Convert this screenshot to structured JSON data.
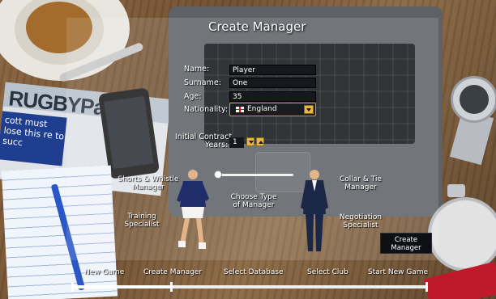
{
  "screen": {
    "title": "Create Manager"
  },
  "background": {
    "newspaper_masthead": "RUGBYPa",
    "newspaper_snippet": "cott must lose this re to succ"
  },
  "form": {
    "name": {
      "label": "Name:",
      "value": "Player"
    },
    "surname": {
      "label": "Surname:",
      "value": "One"
    },
    "age": {
      "label": "Age:",
      "value": "35"
    },
    "nationality": {
      "label": "Nationality:",
      "value": "England"
    },
    "contract": {
      "label_line1": "Initial Contract",
      "label_line2": "Years:",
      "value": "1"
    }
  },
  "manager_type": {
    "left_top": {
      "line1": "Shorts & Whistle",
      "line2": "Manager"
    },
    "left_bottom": {
      "line1": "Training",
      "line2": "Specialist"
    },
    "center": {
      "line1": "Choose Type",
      "line2": "of Manager"
    },
    "right_top": {
      "line1": "Collar & Tie",
      "line2": "Manager"
    },
    "right_bottom": {
      "line1": "Negotiation",
      "line2": "Specialist"
    },
    "slider_position": 0
  },
  "actions": {
    "create": {
      "line1": "Create",
      "line2": "Manager"
    }
  },
  "steps": {
    "items": [
      "New Game",
      "Create Manager",
      "Select Database",
      "Select Club",
      "Start New Game"
    ],
    "current_index": 1,
    "progress_fraction": 0.28
  },
  "colors": {
    "accent": "#e6b84a",
    "field_bg": "#15181c",
    "text": "#ffffff"
  }
}
